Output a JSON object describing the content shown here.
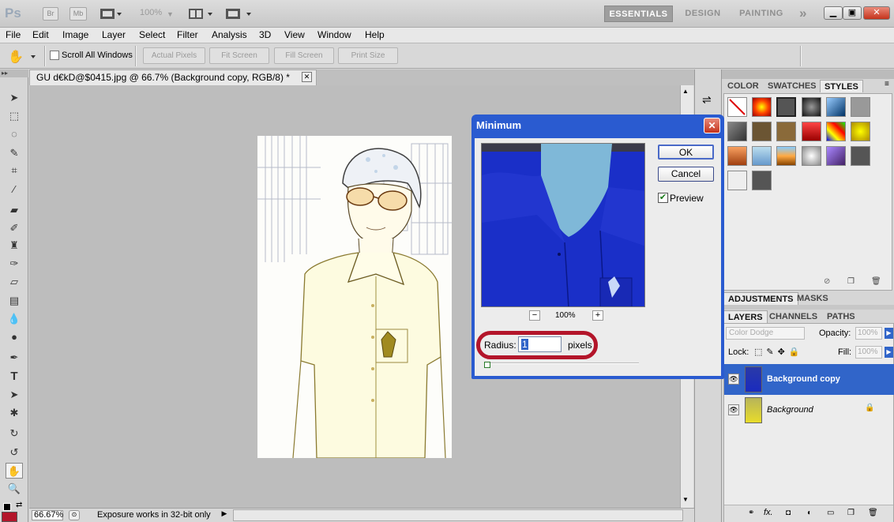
{
  "appbar": {
    "logo": "Ps",
    "bridge": "Br",
    "minibridge": "Mb",
    "zoom": "100%",
    "workspaces": [
      "ESSENTIALS",
      "DESIGN",
      "PAINTING"
    ],
    "more": "»"
  },
  "menu": [
    "File",
    "Edit",
    "Image",
    "Layer",
    "Select",
    "Filter",
    "Analysis",
    "3D",
    "View",
    "Window",
    "Help"
  ],
  "options": {
    "scroll_all": "Scroll All Windows",
    "buttons": [
      "Actual Pixels",
      "Fit Screen",
      "Fill Screen",
      "Print Size"
    ]
  },
  "document": {
    "tab_title": "GU d€kD@$0415.jpg @ 66.7% (Background copy, RGB/8) *",
    "close": "✕"
  },
  "status": {
    "zoom": "66.67%",
    "message": "Exposure works in 32-bit only"
  },
  "dialog": {
    "title": "Minimum",
    "ok": "OK",
    "cancel": "Cancel",
    "preview_label": "Preview",
    "preview_checked": true,
    "zoom_level": "100%",
    "minus": "−",
    "plus": "+",
    "radius_label": "Radius:",
    "radius_value": "1",
    "radius_unit": "pixels"
  },
  "panels": {
    "top_tabs": [
      "COLOR",
      "SWATCHES",
      "STYLES"
    ],
    "mid_tabs": [
      "ADJUSTMENTS",
      "MASKS"
    ],
    "layer_tabs": [
      "LAYERS",
      "CHANNELS",
      "PATHS"
    ],
    "blend_mode": "Color Dodge",
    "opacity_label": "Opacity:",
    "opacity_value": "100%",
    "lock_label": "Lock:",
    "fill_label": "Fill:",
    "fill_value": "100%",
    "layers": [
      {
        "name": "Background copy",
        "selected": true
      },
      {
        "name": "Background",
        "selected": false
      }
    ]
  },
  "colors": {
    "accent": "#3165c9",
    "dialog_border": "#2a5bd0",
    "highlight_annotation": "#b3152a"
  }
}
